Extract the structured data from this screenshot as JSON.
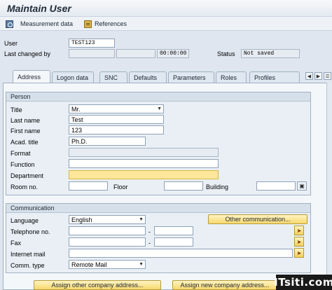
{
  "window": {
    "title": "Maintain User"
  },
  "toolbar": {
    "measurement_label": "Measurement data",
    "references_label": "References"
  },
  "header": {
    "user_label": "User",
    "user_value": "TEST123",
    "last_changed_label": "Last changed by",
    "time_value": "00:00:00",
    "status_label": "Status",
    "status_value": "Not saved"
  },
  "tabs": [
    "Address",
    "Logon data",
    "SNC",
    "Defaults",
    "Parameters",
    "Roles",
    "Profiles"
  ],
  "active_tab": "Address",
  "person": {
    "group_title": "Person",
    "title_label": "Title",
    "title_value": "Mr.",
    "last_name_label": "Last name",
    "last_name_value": "Test",
    "first_name_label": "First name",
    "first_name_value": "123",
    "acad_title_label": "Acad. title",
    "acad_title_value": "Ph.D.",
    "format_label": "Format",
    "format_value": "",
    "function_label": "Function",
    "function_value": "",
    "department_label": "Department",
    "department_value": "",
    "room_label": "Room no.",
    "room_value": "",
    "floor_label": "Floor",
    "floor_value": "",
    "building_label": "Building",
    "building_value": ""
  },
  "communication": {
    "group_title": "Communication",
    "language_label": "Language",
    "language_value": "English",
    "other_comm_button": "Other communication...",
    "telephone_label": "Telephone no.",
    "telephone_value": "",
    "telephone_ext_value": "",
    "fax_label": "Fax",
    "fax_value": "",
    "fax_ext_value": "",
    "email_label": "Internet mail",
    "email_value": "",
    "comm_type_label": "Comm. type",
    "comm_type_value": "Remote Mail",
    "dash": "-"
  },
  "buttons": {
    "assign_other": "Assign other company address...",
    "assign_new": "Assign new company address..."
  },
  "watermark": "ITsiti.com",
  "colors": {
    "required_field": "#fde79a",
    "button": "#f6d86e",
    "panel": "#f4f7fa"
  }
}
